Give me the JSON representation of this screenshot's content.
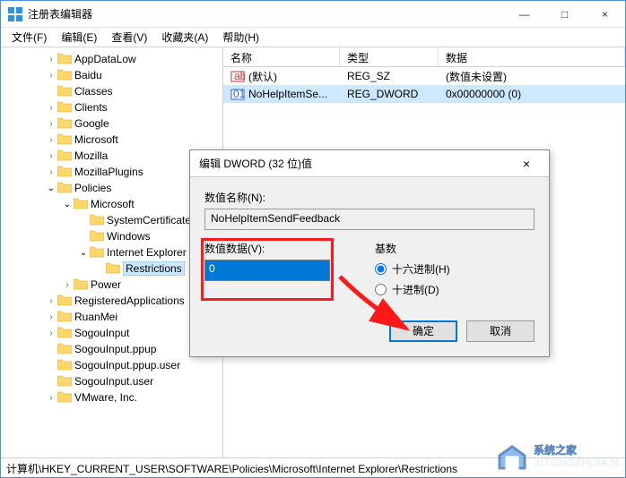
{
  "window": {
    "title": "注册表编辑器",
    "buttons": {
      "min": "—",
      "max": "□",
      "close": "×"
    }
  },
  "menu": {
    "file": "文件(F)",
    "edit": "编辑(E)",
    "view": "查看(V)",
    "fav": "收藏夹(A)",
    "help": "帮助(H)"
  },
  "tree": [
    {
      "depth": 0,
      "exp": ">",
      "label": "AppDataLow"
    },
    {
      "depth": 0,
      "exp": ">",
      "label": "Baidu"
    },
    {
      "depth": 0,
      "exp": "",
      "label": "Classes"
    },
    {
      "depth": 0,
      "exp": ">",
      "label": "Clients"
    },
    {
      "depth": 0,
      "exp": ">",
      "label": "Google"
    },
    {
      "depth": 0,
      "exp": ">",
      "label": "Microsoft"
    },
    {
      "depth": 0,
      "exp": ">",
      "label": "Mozilla"
    },
    {
      "depth": 0,
      "exp": ">",
      "label": "MozillaPlugins"
    },
    {
      "depth": 0,
      "exp": "v",
      "label": "Policies"
    },
    {
      "depth": 1,
      "exp": "v",
      "label": "Microsoft"
    },
    {
      "depth": 2,
      "exp": "",
      "label": "SystemCertificates"
    },
    {
      "depth": 2,
      "exp": "",
      "label": "Windows"
    },
    {
      "depth": 2,
      "exp": "v",
      "label": "Internet Explorer"
    },
    {
      "depth": 3,
      "exp": "",
      "label": "Restrictions",
      "selected": true
    },
    {
      "depth": 1,
      "exp": ">",
      "label": "Power"
    },
    {
      "depth": 0,
      "exp": ">",
      "label": "RegisteredApplications"
    },
    {
      "depth": 0,
      "exp": ">",
      "label": "RuanMei"
    },
    {
      "depth": 0,
      "exp": ">",
      "label": "SogouInput"
    },
    {
      "depth": 0,
      "exp": "",
      "label": "SogouInput.ppup"
    },
    {
      "depth": 0,
      "exp": "",
      "label": "SogouInput.ppup.user"
    },
    {
      "depth": 0,
      "exp": "",
      "label": "SogouInput.user"
    },
    {
      "depth": 0,
      "exp": ">",
      "label": "VMware, Inc."
    }
  ],
  "list": {
    "headers": {
      "name": "名称",
      "type": "类型",
      "data": "数据"
    },
    "rows": [
      {
        "icon": "sz",
        "name": "(默认)",
        "type": "REG_SZ",
        "data": "(数值未设置)"
      },
      {
        "icon": "dw",
        "name": "NoHelpItemSe...",
        "type": "REG_DWORD",
        "data": "0x00000000 (0)",
        "selected": true
      }
    ]
  },
  "statusbar": "计算机\\HKEY_CURRENT_USER\\SOFTWARE\\Policies\\Microsoft\\Internet Explorer\\Restrictions",
  "dialog": {
    "title": "编辑 DWORD (32 位)值",
    "name_label": "数值名称(N):",
    "name_value": "NoHelpItemSendFeedback",
    "data_label": "数值数据(V):",
    "data_value": "0",
    "base_label": "基数",
    "radix_hex": "十六进制(H)",
    "radix_dec": "十进制(D)",
    "ok": "确定",
    "cancel": "取消",
    "close": "×"
  },
  "watermark": {
    "line1": "系统之家",
    "line2": "XITONGZHIJIA.NET"
  }
}
